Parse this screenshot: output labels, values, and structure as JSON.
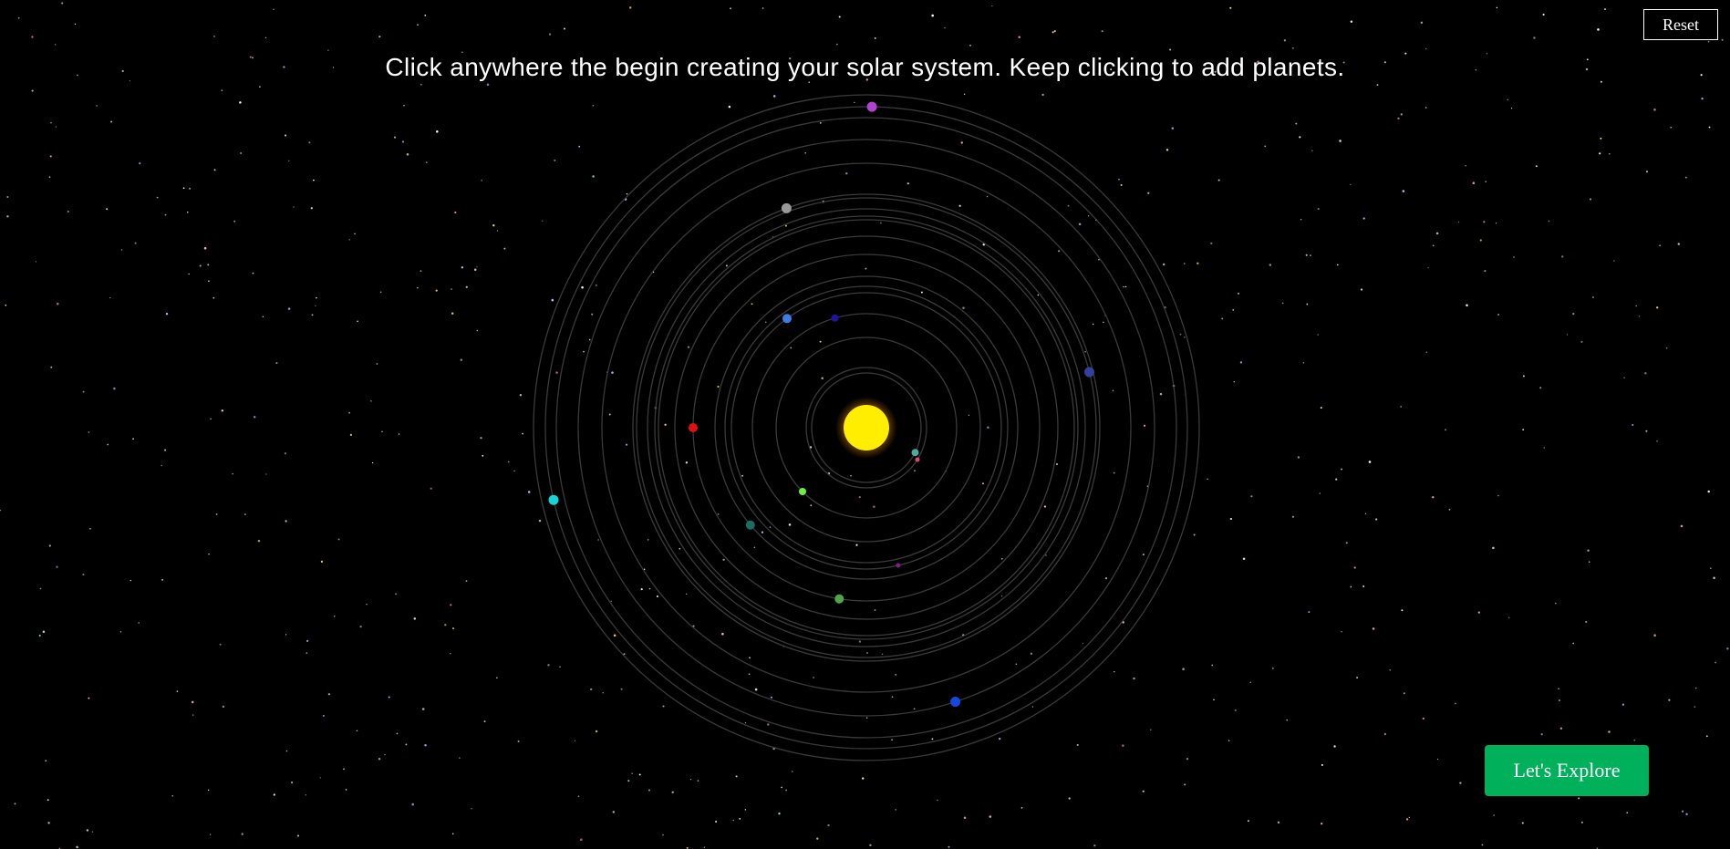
{
  "instruction": "Click anywhere the begin creating your solar system. Keep clicking to add planets.",
  "reset_label": "Reset",
  "explore_label": "Let's Explore",
  "colors": {
    "background": "#000000",
    "orbit": "#3a3a3a",
    "sun": "#ffee00",
    "sun_glow": "#ffb300",
    "button_green": "#00b05a"
  },
  "solar_system": {
    "sun": {
      "color": "#ffee00"
    },
    "planets": [
      {
        "orbit_radius": 60,
        "angle_deg": 27,
        "color": "#4fa8a0"
      },
      {
        "orbit_radius": 66,
        "angle_deg": 32,
        "color": "#e0467c"
      },
      {
        "orbit_radius": 99,
        "angle_deg": 135,
        "color": "#6df03d"
      },
      {
        "orbit_radius": 125,
        "angle_deg": 254,
        "color": "#21139f"
      },
      {
        "orbit_radius": 148,
        "angle_deg": 234,
        "color": "#3b7ee5"
      },
      {
        "orbit_radius": 155,
        "angle_deg": 77,
        "color": "#7a2280"
      },
      {
        "orbit_radius": 166,
        "angle_deg": 140,
        "color": "#1a6e60"
      },
      {
        "orbit_radius": 190,
        "angle_deg": 99,
        "color": "#4ea646"
      },
      {
        "orbit_radius": 190,
        "angle_deg": 180,
        "color": "#e01010"
      },
      {
        "orbit_radius": 252,
        "angle_deg": 346,
        "color": "#33409c"
      },
      {
        "orbit_radius": 256,
        "angle_deg": 250,
        "color": "#9a9a9a"
      },
      {
        "orbit_radius": 316,
        "angle_deg": 72,
        "color": "#1448e0"
      },
      {
        "orbit_radius": 352,
        "angle_deg": 167,
        "color": "#14d4d8"
      },
      {
        "orbit_radius": 352,
        "angle_deg": 271,
        "color": "#b044d0"
      }
    ],
    "orbit_radii": [
      60,
      66,
      99,
      125,
      148,
      155,
      166,
      190,
      210,
      228,
      232,
      240,
      252,
      256,
      290,
      316,
      340,
      352,
      365
    ]
  }
}
